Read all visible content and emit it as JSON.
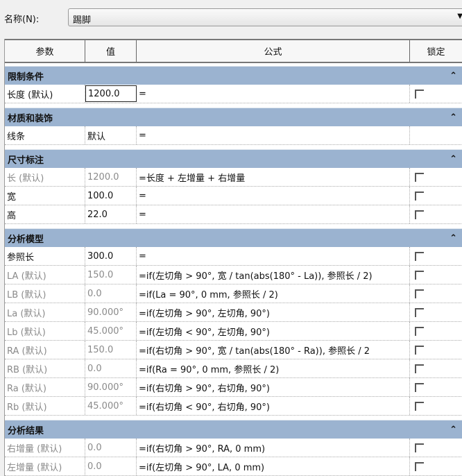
{
  "name_label": "名称(N):",
  "name_value": "踢脚",
  "headers": {
    "param": "参数",
    "value": "值",
    "formula": "公式",
    "lock": "锁定"
  },
  "groups": [
    {
      "title": "限制条件",
      "rows": [
        {
          "param": "长度 (默认)",
          "value": "1200.0",
          "formula": "=",
          "gray": false,
          "edit": true,
          "checkbox": true
        }
      ]
    },
    {
      "title": "材质和装饰",
      "rows": [
        {
          "param": "线条",
          "value": "默认",
          "formula": "=",
          "gray": false,
          "checkbox": false
        }
      ]
    },
    {
      "title": "尺寸标注",
      "rows": [
        {
          "param": "长 (默认)",
          "value": "1200.0",
          "formula": "=长度 + 左增量 + 右增量",
          "gray": true,
          "checkbox": true
        },
        {
          "param": "宽",
          "value": "100.0",
          "formula": "=",
          "gray": false,
          "checkbox": true
        },
        {
          "param": "高",
          "value": "22.0",
          "formula": "=",
          "gray": false,
          "checkbox": true
        }
      ]
    },
    {
      "title": "分析模型",
      "rows": [
        {
          "param": "参照长",
          "value": "300.0",
          "formula": "=",
          "gray": false,
          "checkbox": true
        },
        {
          "param": "LA (默认)",
          "value": "150.0",
          "formula": "=if(左切角 > 90°, 宽 / tan(abs(180° - La)), 参照长 / 2)",
          "gray": true,
          "checkbox": true
        },
        {
          "param": "LB (默认)",
          "value": "0.0",
          "formula": "=if(La = 90°, 0 mm, 参照长 / 2)",
          "gray": true,
          "checkbox": true
        },
        {
          "param": "La (默认)",
          "value": "90.000°",
          "formula": "=if(左切角 > 90°, 左切角, 90°)",
          "gray": true,
          "checkbox": true
        },
        {
          "param": "Lb (默认)",
          "value": "45.000°",
          "formula": "=if(左切角 < 90°, 左切角, 90°)",
          "gray": true,
          "checkbox": true
        },
        {
          "param": "RA (默认)",
          "value": "150.0",
          "formula": "=if(右切角 > 90°, 宽 / tan(abs(180° - Ra)), 参照长 / 2",
          "gray": true,
          "checkbox": true
        },
        {
          "param": "RB (默认)",
          "value": "0.0",
          "formula": "=if(Ra = 90°, 0 mm, 参照长 / 2)",
          "gray": true,
          "checkbox": true
        },
        {
          "param": "Ra (默认)",
          "value": "90.000°",
          "formula": "=if(右切角 > 90°, 右切角, 90°)",
          "gray": true,
          "checkbox": true
        },
        {
          "param": "Rb (默认)",
          "value": "45.000°",
          "formula": "=if(右切角 < 90°, 右切角, 90°)",
          "gray": true,
          "checkbox": true
        }
      ]
    },
    {
      "title": "分析结果",
      "rows": [
        {
          "param": "右增量 (默认)",
          "value": "0.0",
          "formula": "=if(右切角 > 90°, RA, 0 mm)",
          "gray": true,
          "checkbox": true
        },
        {
          "param": "左增量 (默认)",
          "value": "0.0",
          "formula": "=if(左切角 > 90°, LA, 0 mm)",
          "gray": true,
          "checkbox": true
        }
      ]
    }
  ]
}
